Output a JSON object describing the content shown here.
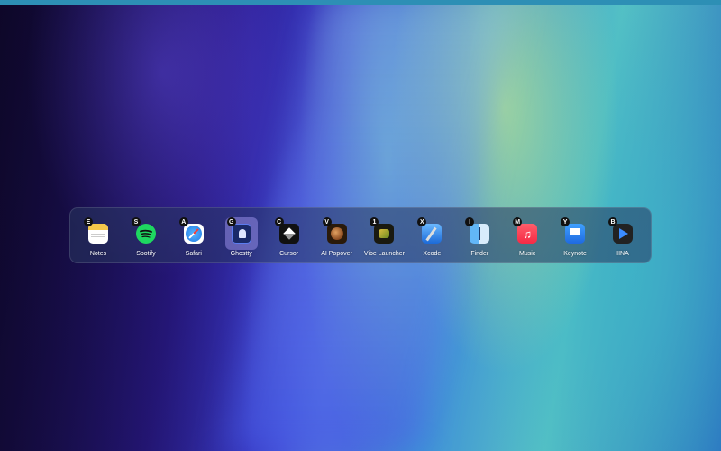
{
  "app_switcher": {
    "apps": [
      {
        "name": "Notes",
        "hotkey": "E",
        "icon": "notes-icon"
      },
      {
        "name": "Spotify",
        "hotkey": "S",
        "icon": "spotify-icon"
      },
      {
        "name": "Safari",
        "hotkey": "A",
        "icon": "safari-icon"
      },
      {
        "name": "Ghostty",
        "hotkey": "G",
        "icon": "ghostty-icon",
        "selected": true
      },
      {
        "name": "Cursor",
        "hotkey": "C",
        "icon": "cursor-icon"
      },
      {
        "name": "AI Popover",
        "hotkey": "V",
        "icon": "ai-popover-icon"
      },
      {
        "name": "Vibe Launcher",
        "hotkey": "1",
        "icon": "vibe-launcher-icon"
      },
      {
        "name": "Xcode",
        "hotkey": "X",
        "icon": "xcode-icon"
      },
      {
        "name": "Finder",
        "hotkey": "I",
        "icon": "finder-icon"
      },
      {
        "name": "Music",
        "hotkey": "M",
        "icon": "music-icon"
      },
      {
        "name": "Keynote",
        "hotkey": "Y",
        "icon": "keynote-icon"
      },
      {
        "name": "IINA",
        "hotkey": "B",
        "icon": "iina-icon"
      }
    ]
  },
  "colors": {
    "spotify": "#1ed760",
    "music": "#f62a45",
    "selection": "#9a8ce6"
  }
}
